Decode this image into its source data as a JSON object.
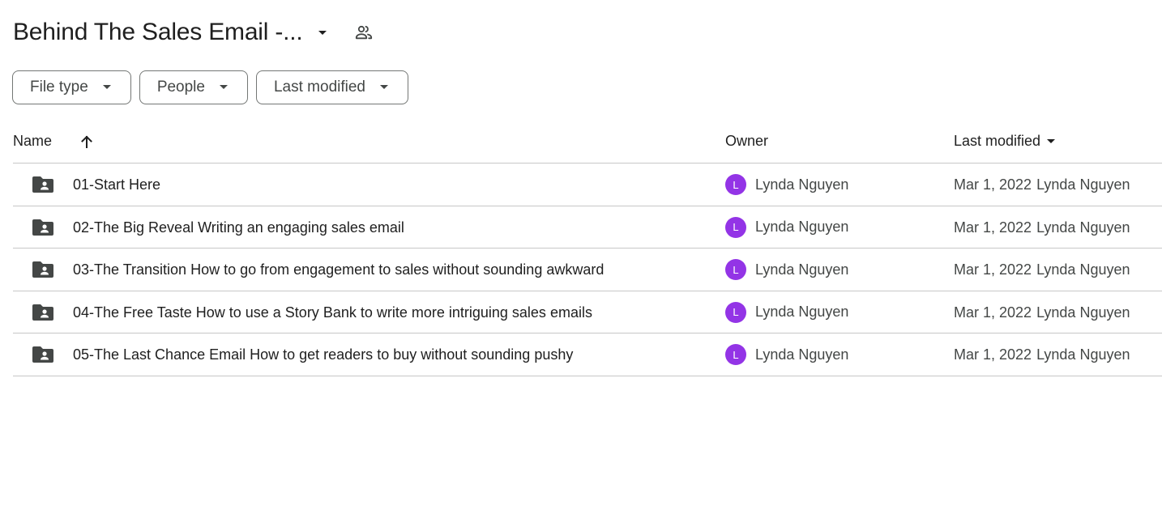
{
  "header": {
    "title": "Behind The Sales Email -...",
    "title_menu_icon": "arrow-drop-down-icon",
    "shared_icon": "people-icon"
  },
  "filters": [
    {
      "label": "File type",
      "icon": "arrow-drop-down-icon"
    },
    {
      "label": "People",
      "icon": "arrow-drop-down-icon"
    },
    {
      "label": "Last modified",
      "icon": "arrow-drop-down-icon"
    }
  ],
  "table": {
    "columns": {
      "name": "Name",
      "owner": "Owner",
      "last_modified": "Last modified"
    },
    "sort_icon": "arrow-up-icon",
    "rows": [
      {
        "name": "01-Start Here",
        "owner_initial": "L",
        "owner": "Lynda Nguyen",
        "modified_date": "Mar 1, 2022",
        "modified_by": "Lynda Nguyen"
      },
      {
        "name": "02-The Big Reveal Writing an engaging sales email",
        "owner_initial": "L",
        "owner": "Lynda Nguyen",
        "modified_date": "Mar 1, 2022",
        "modified_by": "Lynda Nguyen"
      },
      {
        "name": "03-The Transition How to go from engagement to sales without sounding awkward",
        "owner_initial": "L",
        "owner": "Lynda Nguyen",
        "modified_date": "Mar 1, 2022",
        "modified_by": "Lynda Nguyen"
      },
      {
        "name": "04-The Free Taste How to use a Story Bank to write more intriguing sales emails",
        "owner_initial": "L",
        "owner": "Lynda Nguyen",
        "modified_date": "Mar 1, 2022",
        "modified_by": "Lynda Nguyen"
      },
      {
        "name": "05-The Last Chance Email How to get readers to buy without sounding pushy",
        "owner_initial": "L",
        "owner": "Lynda Nguyen",
        "modified_date": "Mar 1, 2022",
        "modified_by": "Lynda Nguyen"
      }
    ]
  },
  "colors": {
    "avatar": "#9334e6",
    "text_primary": "#1f1f1f",
    "text_secondary": "#444746",
    "divider": "#c7c7c7",
    "chip_border": "#747775"
  }
}
